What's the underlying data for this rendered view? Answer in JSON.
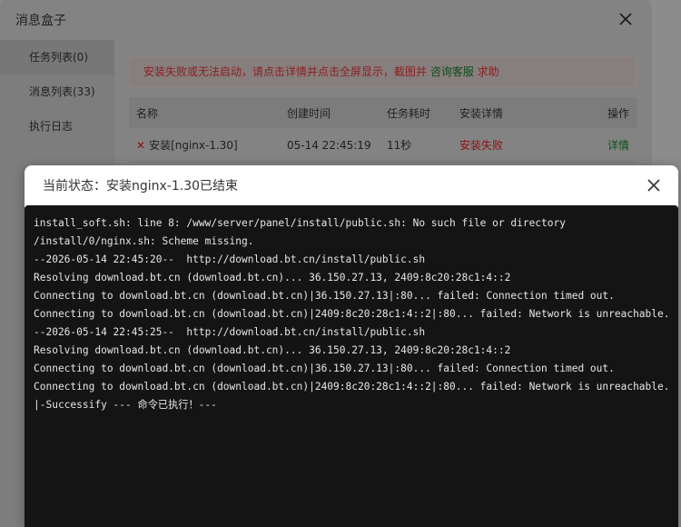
{
  "message_box": {
    "title": "消息盒子",
    "sidebar": [
      {
        "label": "任务列表(0)"
      },
      {
        "label": "消息列表(33)"
      },
      {
        "label": "执行日志"
      }
    ],
    "alert": {
      "text": "安装失败或无法启动，请点击详情并点击全屏显示，截图并 ",
      "link": "咨询客服",
      "suffix": " 求助"
    },
    "table": {
      "headers": [
        "名称",
        "创建时间",
        "任务耗时",
        "安装详情",
        "操作"
      ],
      "rows": [
        {
          "name": "安装[nginx-1.30]",
          "created": "05-14 22:45:19",
          "duration": "11秒",
          "status": "安装失败",
          "action": "详情"
        }
      ]
    }
  },
  "log_dialog": {
    "title": "当前状态：安装nginx-1.30已结束",
    "lines": [
      "install_soft.sh: line 8: /www/server/panel/install/public.sh: No such file or directory",
      "/install/0/nginx.sh: Scheme missing.",
      "--2026-05-14 22:45:20--  http://download.bt.cn/install/public.sh",
      "Resolving download.bt.cn (download.bt.cn)... 36.150.27.13, 2409:8c20:28c1:4::2",
      "Connecting to download.bt.cn (download.bt.cn)|36.150.27.13|:80... failed: Connection timed out.",
      "Connecting to download.bt.cn (download.bt.cn)|2409:8c20:28c1:4::2|:80... failed: Network is unreachable.",
      "--2026-05-14 22:45:25--  http://download.bt.cn/install/public.sh",
      "Resolving download.bt.cn (download.bt.cn)... 36.150.27.13, 2409:8c20:28c1:4::2",
      "Connecting to download.bt.cn (download.bt.cn)|36.150.27.13|:80... failed: Connection timed out.",
      "Connecting to download.bt.cn (download.bt.cn)|2409:8c20:28c1:4::2|:80... failed: Network is unreachable.",
      "|-Successify --- 命令已执行！---"
    ]
  },
  "icons": {
    "close": "close-icon",
    "fail": "fail-x-icon"
  },
  "colors": {
    "terminal_bg": "#141414",
    "terminal_text": "#e6e6e6",
    "fail_red": "#e23434",
    "link_green": "#20a53a"
  }
}
